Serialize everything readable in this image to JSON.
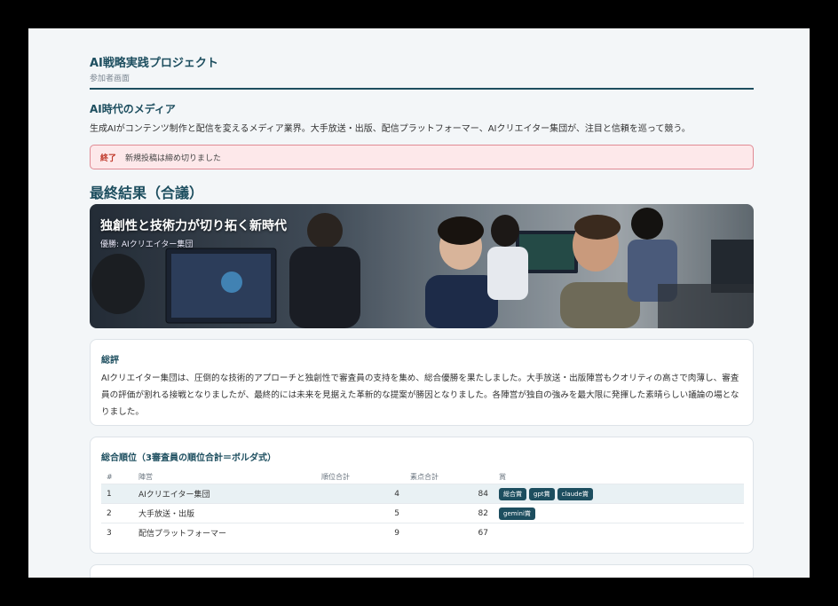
{
  "app": {
    "title": "AI戦略実践プロジェクト",
    "subtitle": "参加者画面"
  },
  "theme": {
    "title": "AI時代のメディア",
    "description": "生成AIがコンテンツ制作と配信を変えるメディア業界。大手放送・出版、配信プラットフォーマー、AIクリエイター集団が、注目と信頼を巡って競う。"
  },
  "alert": {
    "tag": "終了",
    "message": "新規投稿は締め切りました"
  },
  "result": {
    "section_title": "最終結果（合議）",
    "hero_title": "独創性と技術力が切り拓く新時代",
    "hero_winner": "優勝: AIクリエイター集団"
  },
  "review": {
    "title": "総評",
    "text": "AIクリエイター集団は、圧倒的な技術的アプローチと独創性で審査員の支持を集め、総合優勝を果たしました。大手放送・出版陣営もクオリティの高さで肉薄し、審査員の評価が割れる接戦となりましたが、最終的には未来を見据えた革新的な提案が勝因となりました。各陣営が独自の強みを最大限に発揮した素晴らしい議論の場となりました。"
  },
  "ranking": {
    "title": "総合順位（3審査員の順位合計＝ボルダ式）",
    "headers": {
      "num": "#",
      "team": "陣営",
      "rank_sum": "順位合計",
      "raw_sum": "素点合計",
      "prize": "賞"
    },
    "rows": [
      {
        "num": "1",
        "team": "AIクリエイター集団",
        "rank_sum": "4",
        "raw_sum": "84",
        "prizes": [
          "総合賞",
          "gpt賞",
          "claude賞"
        ]
      },
      {
        "num": "2",
        "team": "大手放送・出版",
        "rank_sum": "5",
        "raw_sum": "82",
        "prizes": [
          "gemini賞"
        ]
      },
      {
        "num": "3",
        "team": "配信プラットフォーマー",
        "rank_sum": "9",
        "raw_sum": "67",
        "prizes": []
      }
    ]
  },
  "colors": {
    "accent": "#1d4e5f",
    "alert_bg": "#fde8ea",
    "alert_text": "#c0392b"
  }
}
